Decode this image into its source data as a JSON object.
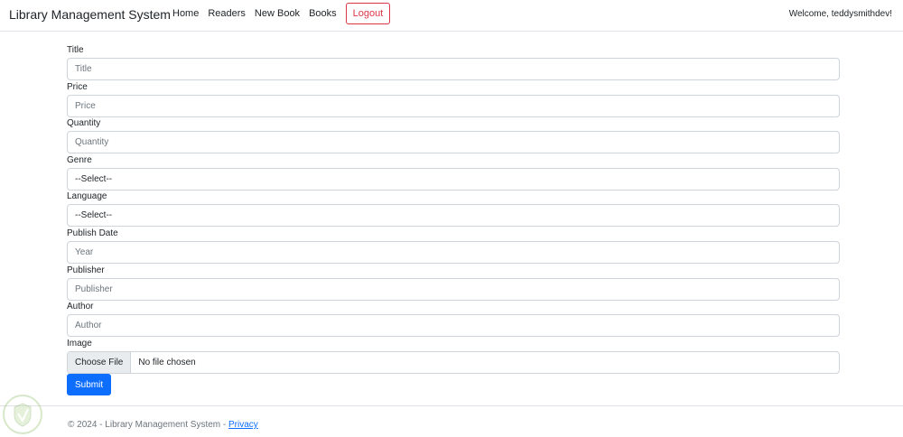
{
  "navbar": {
    "brand": "Library Management System",
    "links": [
      "Home",
      "Readers",
      "New Book",
      "Books"
    ],
    "logout_label": "Logout",
    "welcome": "Welcome, teddysmithdev!"
  },
  "form": {
    "fields": [
      {
        "label": "Title",
        "placeholder": "Title",
        "type": "text"
      },
      {
        "label": "Price",
        "placeholder": "Price",
        "type": "text"
      },
      {
        "label": "Quantity",
        "placeholder": "Quantity",
        "type": "text"
      },
      {
        "label": "Genre",
        "value": "--Select--",
        "type": "select"
      },
      {
        "label": "Language",
        "value": "--Select--",
        "type": "select"
      },
      {
        "label": "Publish Date",
        "placeholder": "Year",
        "type": "text"
      },
      {
        "label": "Publisher",
        "placeholder": "Publisher",
        "type": "text"
      },
      {
        "label": "Author",
        "placeholder": "Author",
        "type": "text"
      }
    ],
    "image": {
      "label": "Image",
      "button_label": "Choose File",
      "status": "No file chosen"
    },
    "submit_label": "Submit"
  },
  "footer": {
    "text": "© 2024 - Library Management System - ",
    "privacy_link": "Privacy"
  },
  "colors": {
    "primary": "#0d6efd",
    "danger": "#dc3545",
    "border": "#ced4da"
  }
}
